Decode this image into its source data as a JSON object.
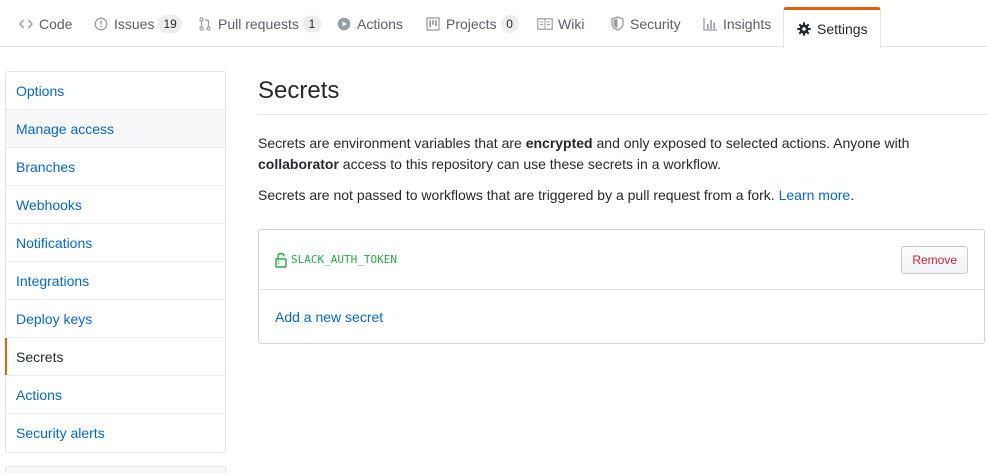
{
  "tabs": [
    {
      "label": "Code",
      "icon": "code-icon"
    },
    {
      "label": "Issues",
      "icon": "issue-icon",
      "count": "19"
    },
    {
      "label": "Pull requests",
      "icon": "pull-request-icon",
      "count": "1"
    },
    {
      "label": "Actions",
      "icon": "play-icon"
    },
    {
      "label": "Projects",
      "icon": "project-icon",
      "count": "0"
    },
    {
      "label": "Wiki",
      "icon": "book-icon"
    },
    {
      "label": "Security",
      "icon": "shield-icon"
    },
    {
      "label": "Insights",
      "icon": "graph-icon"
    },
    {
      "label": "Settings",
      "icon": "gear-icon",
      "selected": true
    }
  ],
  "sidebar": {
    "items": [
      {
        "label": "Options"
      },
      {
        "label": "Manage access"
      },
      {
        "label": "Branches"
      },
      {
        "label": "Webhooks"
      },
      {
        "label": "Notifications"
      },
      {
        "label": "Integrations"
      },
      {
        "label": "Deploy keys"
      },
      {
        "label": "Secrets",
        "selected": true
      },
      {
        "label": "Actions"
      },
      {
        "label": "Security alerts"
      }
    ]
  },
  "main": {
    "title": "Secrets",
    "desc_part1": "Secrets are environment variables that are ",
    "desc_bold1": "encrypted",
    "desc_part2": " and only exposed to selected actions. Anyone with ",
    "desc_bold2": "collaborator",
    "desc_part3": " access to this repository can use these secrets in a workflow.",
    "desc2_text": "Secrets are not passed to workflows that are triggered by a pull request from a fork. ",
    "learn_more": "Learn more",
    "desc2_end": ".",
    "secrets": [
      {
        "name": "SLACK_AUTH_TOKEN",
        "remove_label": "Remove"
      }
    ],
    "add_secret": "Add a new secret"
  },
  "colors": {
    "accent": "#e36209",
    "link": "#0366d6",
    "secret_green": "#28a745",
    "danger": "#cb2431"
  }
}
